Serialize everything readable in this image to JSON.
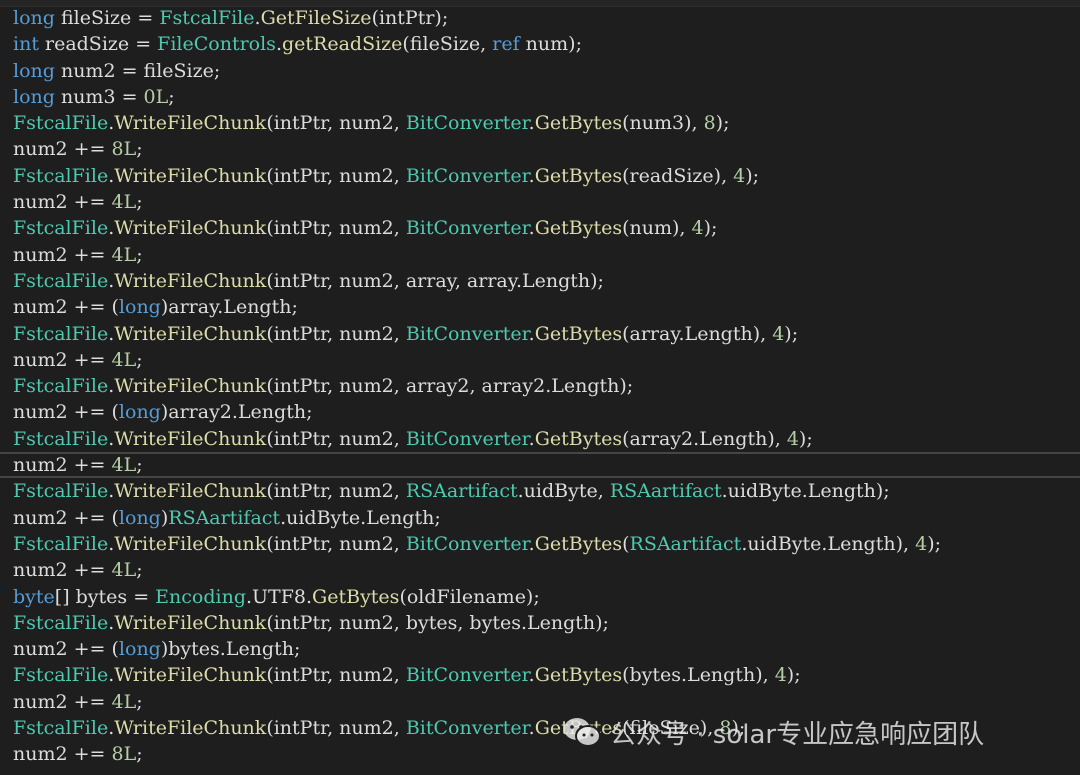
{
  "colors": {
    "background": "#1e1e1e",
    "keyword": "#569cd6",
    "type": "#4ec9b0",
    "method": "#dcdcaa",
    "number": "#b5cea8",
    "variable": "#9cdcfe",
    "plain": "#dcdcdc"
  },
  "watermark": {
    "icon": "wechat-icon",
    "text": "公众号 · solar专业应急响应团队"
  },
  "editor": {
    "current_line_index": 17,
    "lines": [
      [
        [
          "kw",
          "long"
        ],
        [
          "plain",
          " fileSize = "
        ],
        [
          "type",
          "FstcalFile"
        ],
        [
          "plain",
          "."
        ],
        [
          "method",
          "GetFileSize"
        ],
        [
          "plain",
          "(intPtr);"
        ]
      ],
      [
        [
          "kw",
          "int"
        ],
        [
          "plain",
          " readSize = "
        ],
        [
          "type",
          "FileControls"
        ],
        [
          "plain",
          "."
        ],
        [
          "method",
          "getReadSize"
        ],
        [
          "plain",
          "(fileSize, "
        ],
        [
          "kw",
          "ref"
        ],
        [
          "plain",
          " num);"
        ]
      ],
      [
        [
          "kw",
          "long"
        ],
        [
          "plain",
          " num2 = fileSize;"
        ]
      ],
      [
        [
          "kw",
          "long"
        ],
        [
          "plain",
          " num3 = "
        ],
        [
          "num",
          "0L"
        ],
        [
          "plain",
          ";"
        ]
      ],
      [
        [
          "type",
          "FstcalFile"
        ],
        [
          "plain",
          "."
        ],
        [
          "method",
          "WriteFileChunk"
        ],
        [
          "plain",
          "(intPtr, num2, "
        ],
        [
          "type",
          "BitConverter"
        ],
        [
          "plain",
          "."
        ],
        [
          "method",
          "GetBytes"
        ],
        [
          "plain",
          "(num3), "
        ],
        [
          "num",
          "8"
        ],
        [
          "plain",
          ");"
        ]
      ],
      [
        [
          "plain",
          "num2 += "
        ],
        [
          "num",
          "8L"
        ],
        [
          "plain",
          ";"
        ]
      ],
      [
        [
          "type",
          "FstcalFile"
        ],
        [
          "plain",
          "."
        ],
        [
          "method",
          "WriteFileChunk"
        ],
        [
          "plain",
          "(intPtr, num2, "
        ],
        [
          "type",
          "BitConverter"
        ],
        [
          "plain",
          "."
        ],
        [
          "method",
          "GetBytes"
        ],
        [
          "plain",
          "(readSize), "
        ],
        [
          "num",
          "4"
        ],
        [
          "plain",
          ");"
        ]
      ],
      [
        [
          "plain",
          "num2 += "
        ],
        [
          "num",
          "4L"
        ],
        [
          "plain",
          ";"
        ]
      ],
      [
        [
          "type",
          "FstcalFile"
        ],
        [
          "plain",
          "."
        ],
        [
          "method",
          "WriteFileChunk"
        ],
        [
          "plain",
          "(intPtr, num2, "
        ],
        [
          "type",
          "BitConverter"
        ],
        [
          "plain",
          "."
        ],
        [
          "method",
          "GetBytes"
        ],
        [
          "plain",
          "(num), "
        ],
        [
          "num",
          "4"
        ],
        [
          "plain",
          ");"
        ]
      ],
      [
        [
          "plain",
          "num2 += "
        ],
        [
          "num",
          "4L"
        ],
        [
          "plain",
          ";"
        ]
      ],
      [
        [
          "type",
          "FstcalFile"
        ],
        [
          "plain",
          "."
        ],
        [
          "method",
          "WriteFileChunk"
        ],
        [
          "plain",
          "(intPtr, num2, array, array.Length);"
        ]
      ],
      [
        [
          "plain",
          "num2 += ("
        ],
        [
          "kw",
          "long"
        ],
        [
          "plain",
          ")array.Length;"
        ]
      ],
      [
        [
          "type",
          "FstcalFile"
        ],
        [
          "plain",
          "."
        ],
        [
          "method",
          "WriteFileChunk"
        ],
        [
          "plain",
          "(intPtr, num2, "
        ],
        [
          "type",
          "BitConverter"
        ],
        [
          "plain",
          "."
        ],
        [
          "method",
          "GetBytes"
        ],
        [
          "plain",
          "(array.Length), "
        ],
        [
          "num",
          "4"
        ],
        [
          "plain",
          ");"
        ]
      ],
      [
        [
          "plain",
          "num2 += "
        ],
        [
          "num",
          "4L"
        ],
        [
          "plain",
          ";"
        ]
      ],
      [
        [
          "type",
          "FstcalFile"
        ],
        [
          "plain",
          "."
        ],
        [
          "method",
          "WriteFileChunk"
        ],
        [
          "plain",
          "(intPtr, num2, array2, array2.Length);"
        ]
      ],
      [
        [
          "plain",
          "num2 += ("
        ],
        [
          "kw",
          "long"
        ],
        [
          "plain",
          ")array2.Length;"
        ]
      ],
      [
        [
          "type",
          "FstcalFile"
        ],
        [
          "plain",
          "."
        ],
        [
          "method",
          "WriteFileChunk"
        ],
        [
          "plain",
          "(intPtr, num2, "
        ],
        [
          "type",
          "BitConverter"
        ],
        [
          "plain",
          "."
        ],
        [
          "method",
          "GetBytes"
        ],
        [
          "plain",
          "(array2.Length), "
        ],
        [
          "num",
          "4"
        ],
        [
          "plain",
          ");"
        ]
      ],
      [
        [
          "plain",
          "num2 += "
        ],
        [
          "num",
          "4L"
        ],
        [
          "plain",
          ";"
        ]
      ],
      [
        [
          "type",
          "FstcalFile"
        ],
        [
          "plain",
          "."
        ],
        [
          "method",
          "WriteFileChunk"
        ],
        [
          "plain",
          "(intPtr, num2, "
        ],
        [
          "type",
          "RSAartifact"
        ],
        [
          "plain",
          ".uidByte, "
        ],
        [
          "type",
          "RSAartifact"
        ],
        [
          "plain",
          ".uidByte.Length);"
        ]
      ],
      [
        [
          "plain",
          "num2 += ("
        ],
        [
          "kw",
          "long"
        ],
        [
          "plain",
          ")"
        ],
        [
          "type",
          "RSAartifact"
        ],
        [
          "plain",
          ".uidByte.Length;"
        ]
      ],
      [
        [
          "type",
          "FstcalFile"
        ],
        [
          "plain",
          "."
        ],
        [
          "method",
          "WriteFileChunk"
        ],
        [
          "plain",
          "(intPtr, num2, "
        ],
        [
          "type",
          "BitConverter"
        ],
        [
          "plain",
          "."
        ],
        [
          "method",
          "GetBytes"
        ],
        [
          "plain",
          "("
        ],
        [
          "type",
          "RSAartifact"
        ],
        [
          "plain",
          ".uidByte.Length), "
        ],
        [
          "num",
          "4"
        ],
        [
          "plain",
          ");"
        ]
      ],
      [
        [
          "plain",
          "num2 += "
        ],
        [
          "num",
          "4L"
        ],
        [
          "plain",
          ";"
        ]
      ],
      [
        [
          "kw",
          "byte"
        ],
        [
          "plain",
          "[] bytes = "
        ],
        [
          "type",
          "Encoding"
        ],
        [
          "plain",
          ".UTF8."
        ],
        [
          "method",
          "GetBytes"
        ],
        [
          "plain",
          "(oldFilename);"
        ]
      ],
      [
        [
          "type",
          "FstcalFile"
        ],
        [
          "plain",
          "."
        ],
        [
          "method",
          "WriteFileChunk"
        ],
        [
          "plain",
          "(intPtr, num2, bytes, bytes.Length);"
        ]
      ],
      [
        [
          "plain",
          "num2 += ("
        ],
        [
          "kw",
          "long"
        ],
        [
          "plain",
          ")bytes.Length;"
        ]
      ],
      [
        [
          "type",
          "FstcalFile"
        ],
        [
          "plain",
          "."
        ],
        [
          "method",
          "WriteFileChunk"
        ],
        [
          "plain",
          "(intPtr, num2, "
        ],
        [
          "type",
          "BitConverter"
        ],
        [
          "plain",
          "."
        ],
        [
          "method",
          "GetBytes"
        ],
        [
          "plain",
          "(bytes.Length), "
        ],
        [
          "num",
          "4"
        ],
        [
          "plain",
          ");"
        ]
      ],
      [
        [
          "plain",
          "num2 += "
        ],
        [
          "num",
          "4L"
        ],
        [
          "plain",
          ";"
        ]
      ],
      [
        [
          "type",
          "FstcalFile"
        ],
        [
          "plain",
          "."
        ],
        [
          "method",
          "WriteFileChunk"
        ],
        [
          "plain",
          "(intPtr, num2, "
        ],
        [
          "type",
          "BitConverter"
        ],
        [
          "plain",
          "."
        ],
        [
          "method",
          "GetBytes"
        ],
        [
          "plain",
          "(fileSize), "
        ],
        [
          "num",
          "8"
        ],
        [
          "plain",
          ");"
        ]
      ],
      [
        [
          "plain",
          "num2 += "
        ],
        [
          "num",
          "8L"
        ],
        [
          "plain",
          ";"
        ]
      ]
    ]
  }
}
